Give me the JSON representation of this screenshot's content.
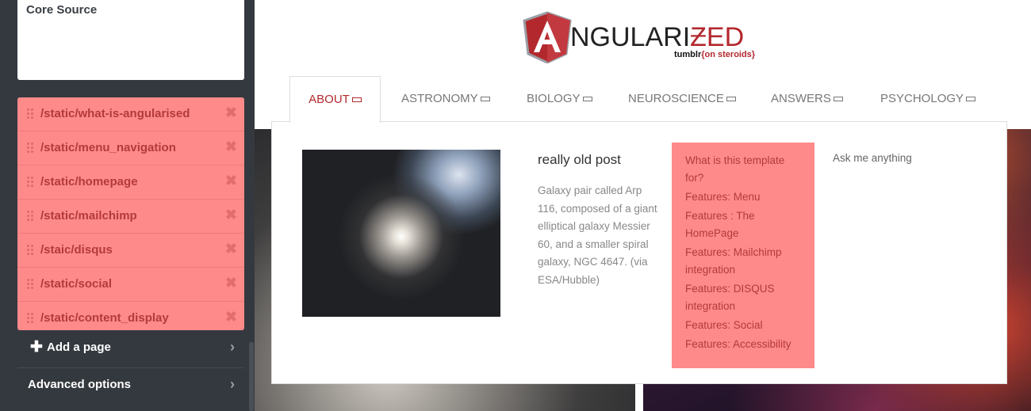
{
  "sidebar": {
    "source_title": "Core Source",
    "pages": [
      {
        "label": "/static/what-is-angularised"
      },
      {
        "label": "/static/menu_navigation"
      },
      {
        "label": "/static/homepage"
      },
      {
        "label": "/static/mailchimp"
      },
      {
        "label": "/staic/disqus"
      },
      {
        "label": "/static/social"
      },
      {
        "label": "/static/content_display"
      }
    ],
    "remove_glyph": "✖",
    "add_page_label": "Add a page",
    "advanced_label": "Advanced options",
    "plus_glyph": "✚",
    "chevron_glyph": "›"
  },
  "preview": {
    "logo": {
      "text_start": "NGULARI",
      "text_accent": "ƵED",
      "tag_start": "tumblr",
      "tag_accent": "{on steroids}"
    },
    "nav": {
      "tabs": [
        {
          "label": "ABOUT"
        },
        {
          "label": "ASTRONOMY"
        },
        {
          "label": "BIOLOGY"
        },
        {
          "label": "NEUROSCIENCE"
        },
        {
          "label": "ANSWERS"
        },
        {
          "label": "PSYCHOLOGY"
        }
      ],
      "active_tab": "ABOUT"
    },
    "megamenu": {
      "post_title": "really old post",
      "post_desc": "Galaxy pair called Arp 116, composed of a giant elliptical galaxy Messier 60, and a smaller spiral galaxy, NGC 4647. (via ESA/Hubble)",
      "links": [
        {
          "label": "What is this template for?"
        },
        {
          "label": "Features: Menu"
        },
        {
          "label": "Features : The HomePage"
        },
        {
          "label": "Features: Mailchimp integration"
        },
        {
          "label": "Features: DISQUS integration"
        },
        {
          "label": "Features: Social"
        },
        {
          "label": "Features: Accessibility"
        }
      ],
      "ask_link": "Ask me anything"
    }
  },
  "colors": {
    "accent": "#b3282d",
    "highlight": "#ff8a8a",
    "sidebar_bg": "#34393f"
  }
}
